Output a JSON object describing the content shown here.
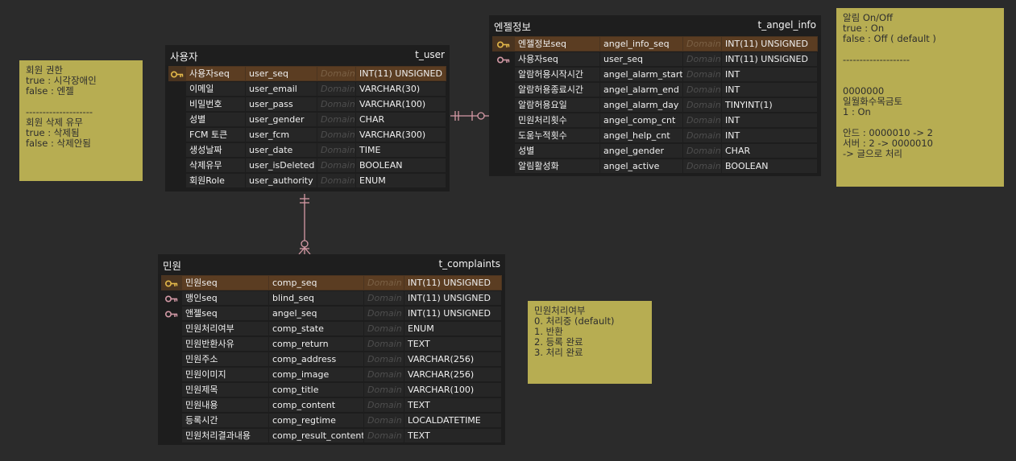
{
  "entities": [
    {
      "logical": "사용자",
      "physical": "t_user",
      "rows": [
        {
          "k": "pk",
          "label": "사용자seq",
          "col": "user_seq",
          "domain": "Domain",
          "type": "INT(11) UNSIGNED"
        },
        {
          "k": "",
          "label": "이메일",
          "col": "user_email",
          "domain": "Domain",
          "type": "VARCHAR(30)"
        },
        {
          "k": "",
          "label": "비밀번호",
          "col": "user_pass",
          "domain": "Domain",
          "type": "VARCHAR(100)"
        },
        {
          "k": "",
          "label": "성별",
          "col": "user_gender",
          "domain": "Domain",
          "type": "CHAR"
        },
        {
          "k": "",
          "label": "FCM 토큰",
          "col": "user_fcm",
          "domain": "Domain",
          "type": "VARCHAR(300)"
        },
        {
          "k": "",
          "label": "생성날짜",
          "col": "user_date",
          "domain": "Domain",
          "type": "TIME"
        },
        {
          "k": "",
          "label": "삭제유무",
          "col": "user_isDeleted",
          "domain": "Domain",
          "type": "BOOLEAN"
        },
        {
          "k": "",
          "label": "회원Role",
          "col": "user_authority",
          "domain": "Domain",
          "type": "ENUM"
        }
      ]
    },
    {
      "logical": "엔젤정보",
      "physical": "t_angel_info",
      "rows": [
        {
          "k": "pk",
          "label": "엔젤정보seq",
          "col": "angel_info_seq",
          "domain": "Domain",
          "type": "INT(11) UNSIGNED"
        },
        {
          "k": "fk",
          "label": "사용자seq",
          "col": "user_seq",
          "domain": "Domain",
          "type": "INT(11) UNSIGNED"
        },
        {
          "k": "",
          "label": "알람허용시작시간",
          "col": "angel_alarm_start",
          "domain": "Domain",
          "type": "INT"
        },
        {
          "k": "",
          "label": "알람허용종료시간",
          "col": "angel_alarm_end",
          "domain": "Domain",
          "type": "INT"
        },
        {
          "k": "",
          "label": "알람허용요일",
          "col": "angel_alarm_day",
          "domain": "Domain",
          "type": "TINYINT(1)"
        },
        {
          "k": "",
          "label": "민원처리횟수",
          "col": "angel_comp_cnt",
          "domain": "Domain",
          "type": "INT"
        },
        {
          "k": "",
          "label": "도움누적횟수",
          "col": "angel_help_cnt",
          "domain": "Domain",
          "type": "INT"
        },
        {
          "k": "",
          "label": "성별",
          "col": "angel_gender",
          "domain": "Domain",
          "type": "CHAR"
        },
        {
          "k": "",
          "label": "알림활성화",
          "col": "angel_active",
          "domain": "Domain",
          "type": "BOOLEAN"
        }
      ]
    },
    {
      "logical": "민원",
      "physical": "t_complaints",
      "rows": [
        {
          "k": "pk",
          "label": "민원seq",
          "col": "comp_seq",
          "domain": "Domain",
          "type": "INT(11) UNSIGNED"
        },
        {
          "k": "fk",
          "label": "맹인seq",
          "col": "blind_seq",
          "domain": "Domain",
          "type": "INT(11) UNSIGNED"
        },
        {
          "k": "fk",
          "label": "앤젤seq",
          "col": "angel_seq",
          "domain": "Domain",
          "type": "INT(11) UNSIGNED"
        },
        {
          "k": "",
          "label": "민원처리여부",
          "col": "comp_state",
          "domain": "Domain",
          "type": "ENUM"
        },
        {
          "k": "",
          "label": "민원반환사유",
          "col": "comp_return",
          "domain": "Domain",
          "type": "TEXT"
        },
        {
          "k": "",
          "label": "민원주소",
          "col": "comp_address",
          "domain": "Domain",
          "type": "VARCHAR(256)"
        },
        {
          "k": "",
          "label": "민원이미지",
          "col": "comp_image",
          "domain": "Domain",
          "type": "VARCHAR(256)"
        },
        {
          "k": "",
          "label": "민원제목",
          "col": "comp_title",
          "domain": "Domain",
          "type": "VARCHAR(100)"
        },
        {
          "k": "",
          "label": "민원내용",
          "col": "comp_content",
          "domain": "Domain",
          "type": "TEXT"
        },
        {
          "k": "",
          "label": "등록시간",
          "col": "comp_regtime",
          "domain": "Domain",
          "type": "LOCALDATETIME"
        },
        {
          "k": "",
          "label": "민원처리결과내용",
          "col": "comp_result_content",
          "domain": "Domain",
          "type": "TEXT"
        }
      ]
    }
  ],
  "memos": [
    {
      "lines": [
        "회원 권한",
        "true : 시각장애인",
        "false : 엔젤",
        "",
        "--------------------",
        "회원 삭제 유무",
        "true : 삭제됨",
        "false : 삭제안됨"
      ]
    },
    {
      "lines": [
        "알림 On/Off",
        "true : On",
        "false : Off ( default )",
        "",
        "--------------------",
        "",
        "",
        "0000000",
        "일월화수목금토",
        "1 : On",
        "",
        "안드 : 0000010 -> 2",
        "서버 : 2 -> 0000010",
        "-> 글으로 처리"
      ]
    },
    {
      "lines": [
        "민원처리여부",
        "0. 처리중 (default)",
        "1. 반환",
        "2. 등록 완료",
        "3. 처리 완료"
      ]
    }
  ],
  "colors": {
    "pk_row": "#5b3d22",
    "pk_key": "#e3b84a",
    "fk_key": "#d39aa6",
    "relation": "#d59aa6",
    "memo": "#b7ad52",
    "background": "#2b2b2b"
  }
}
